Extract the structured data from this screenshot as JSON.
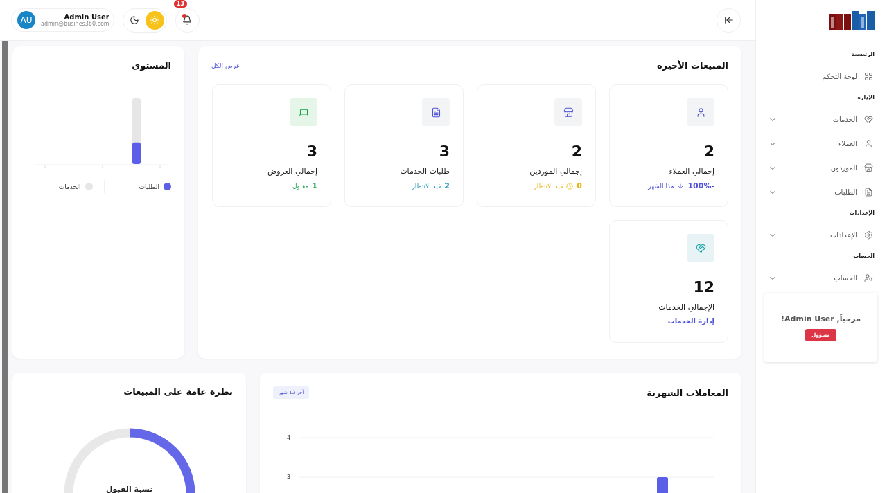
{
  "header": {
    "user": {
      "initials": "AU",
      "name": "Admin User",
      "email": "admin@busines360.com"
    },
    "dark_mode": false,
    "notifications": {
      "count": "13",
      "unread": true
    }
  },
  "sidebar": {
    "sections": [
      {
        "title": "الرئيسية",
        "items": [
          {
            "label": "لوحة التحكم",
            "kind": "dashboard"
          }
        ]
      },
      {
        "title": "الإدارة",
        "items": [
          {
            "label": "الخدمات",
            "kind": "services",
            "expanded": false
          },
          {
            "label": "العملاء",
            "kind": "clients",
            "expanded": false
          },
          {
            "label": "الموردون",
            "kind": "suppliers",
            "expanded": false
          },
          {
            "label": "الطلبات",
            "kind": "orders",
            "expanded": false
          }
        ]
      },
      {
        "title": "الإعدادات",
        "items": [
          {
            "label": "الإعدادات",
            "kind": "settings",
            "expanded": false
          }
        ]
      },
      {
        "title": "الحساب",
        "items": [
          {
            "label": "الحساب",
            "kind": "account",
            "expanded": false
          }
        ]
      }
    ],
    "welcome": {
      "text": "مرحباً, Admin User!",
      "role": "مسؤول"
    }
  },
  "level_panel": {
    "title": "المستوى",
    "level": 0.33,
    "legend": [
      {
        "label": "الطلبات",
        "color": "#5b5ee6"
      },
      {
        "label": "الخدمات",
        "color": "#e6e6e6"
      }
    ]
  },
  "recent_sales": {
    "title": "المبيعات الأخيرة",
    "view_all": "عرض الكل",
    "stats": [
      {
        "kind": "clients",
        "value": "2",
        "label": "إجمالي العملاء",
        "note_value": "-100%",
        "note_text": "هذا الشهر",
        "color": "#4f52d9"
      },
      {
        "kind": "suppliers",
        "value": "2",
        "label": "إجمالي الموردين",
        "note_value": "0",
        "note_text": "قيد الانتظار",
        "color": "#eab308"
      },
      {
        "kind": "requests",
        "value": "3",
        "label": "طلبات الخدمات",
        "note_value": "2",
        "note_text": "قيد الانتظار",
        "color": "#1b93b8"
      },
      {
        "kind": "offers",
        "value": "3",
        "label": "إجمالي العروض",
        "note_value": "1",
        "note_text": "مقبول",
        "color": "#16a34a"
      },
      {
        "kind": "services",
        "value": "12",
        "label": "الإجمالي الخدمات",
        "note_text": "إدارة الخدمات",
        "color": "#4f52d9"
      }
    ]
  },
  "sales_overview": {
    "title": "نظرة عامة على المبيعات",
    "center_label": "نسبة القبول"
  },
  "monthly": {
    "title": "المعاملات الشهرية",
    "range": "آخر 12 شهر",
    "chart_data": {
      "type": "bar",
      "ylim": [
        0,
        4
      ],
      "yticks": [
        3,
        4
      ],
      "series": [
        {
          "values": [
            0,
            0,
            0,
            0,
            0,
            0,
            0,
            0,
            0,
            0,
            3,
            0
          ]
        }
      ]
    }
  }
}
